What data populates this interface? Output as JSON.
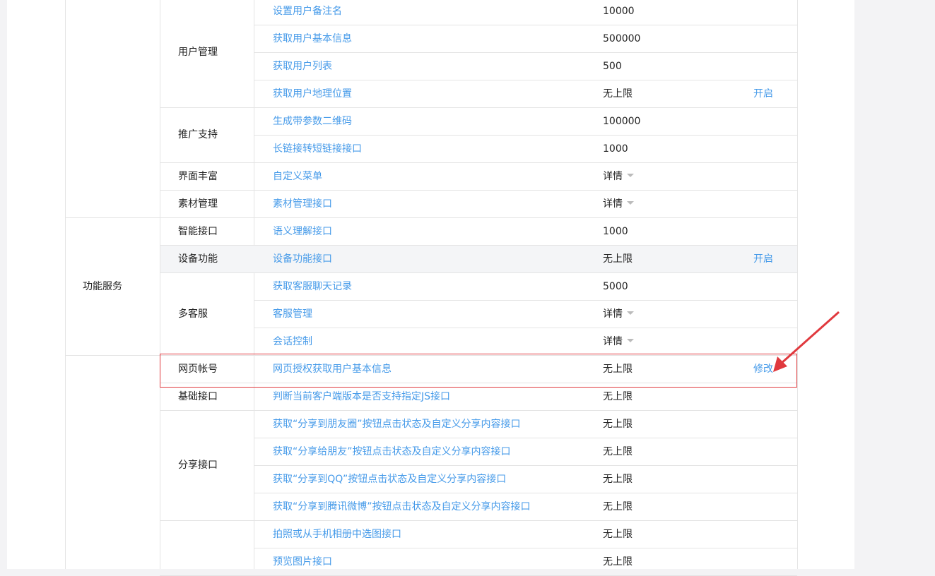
{
  "table": {
    "groups": [
      {
        "label": "用户管理",
        "rows": [
          {
            "name": "设置用户备注名",
            "quota": "10000",
            "action": ""
          },
          {
            "name": "获取用户基本信息",
            "quota": "500000",
            "action": ""
          },
          {
            "name": "获取用户列表",
            "quota": "500",
            "action": ""
          },
          {
            "name": "获取用户地理位置",
            "quota": "无上限",
            "action": "开启"
          }
        ]
      },
      {
        "label": "推广支持",
        "rows": [
          {
            "name": "生成带参数二维码",
            "quota": "100000",
            "action": ""
          },
          {
            "name": "长链接转短链接接口",
            "quota": "1000",
            "action": ""
          }
        ]
      },
      {
        "label": "界面丰富",
        "rows": [
          {
            "name": "自定义菜单",
            "quota": "详情",
            "action": ""
          }
        ]
      },
      {
        "label": "素材管理",
        "rows": [
          {
            "name": "素材管理接口",
            "quota": "详情",
            "action": ""
          }
        ]
      },
      {
        "label": "智能接口",
        "rows": [
          {
            "name": "语义理解接口",
            "quota": "1000",
            "action": ""
          }
        ]
      },
      {
        "label": "设备功能",
        "rows": [
          {
            "name": "设备功能接口",
            "quota": "无上限",
            "action": "开启"
          }
        ]
      },
      {
        "label": "多客服",
        "rows": [
          {
            "name": "获取客服聊天记录",
            "quota": "5000",
            "action": ""
          },
          {
            "name": "客服管理",
            "quota": "详情",
            "action": ""
          },
          {
            "name": "会话控制",
            "quota": "详情",
            "action": ""
          }
        ]
      },
      {
        "label": "网页帐号",
        "rows": [
          {
            "name": "网页授权获取用户基本信息",
            "quota": "无上限",
            "action": "修改"
          }
        ]
      },
      {
        "label": "基础接口",
        "rows": [
          {
            "name": "判断当前客户端版本是否支持指定JS接口",
            "quota": "无上限",
            "action": ""
          }
        ]
      },
      {
        "label": "分享接口",
        "rows": [
          {
            "name": "获取“分享到朋友圈”按钮点击状态及自定义分享内容接口",
            "quota": "无上限",
            "action": ""
          },
          {
            "name": "获取“分享给朋友”按钮点击状态及自定义分享内容接口",
            "quota": "无上限",
            "action": ""
          },
          {
            "name": "获取“分享到QQ”按钮点击状态及自定义分享内容接口",
            "quota": "无上限",
            "action": ""
          },
          {
            "name": "获取“分享到腾讯微博”按钮点击状态及自定义分享内容接口",
            "quota": "无上限",
            "action": ""
          }
        ]
      },
      {
        "label": "",
        "rows": [
          {
            "name": "拍照或从手机相册中选图接口",
            "quota": "无上限",
            "action": ""
          },
          {
            "name": "预览图片接口",
            "quota": "无上限",
            "action": ""
          }
        ]
      }
    ],
    "category_label": "功能服务"
  },
  "colors": {
    "link": "#459ae9",
    "highlight": "#e0393e",
    "arrow": "#e0393e"
  }
}
